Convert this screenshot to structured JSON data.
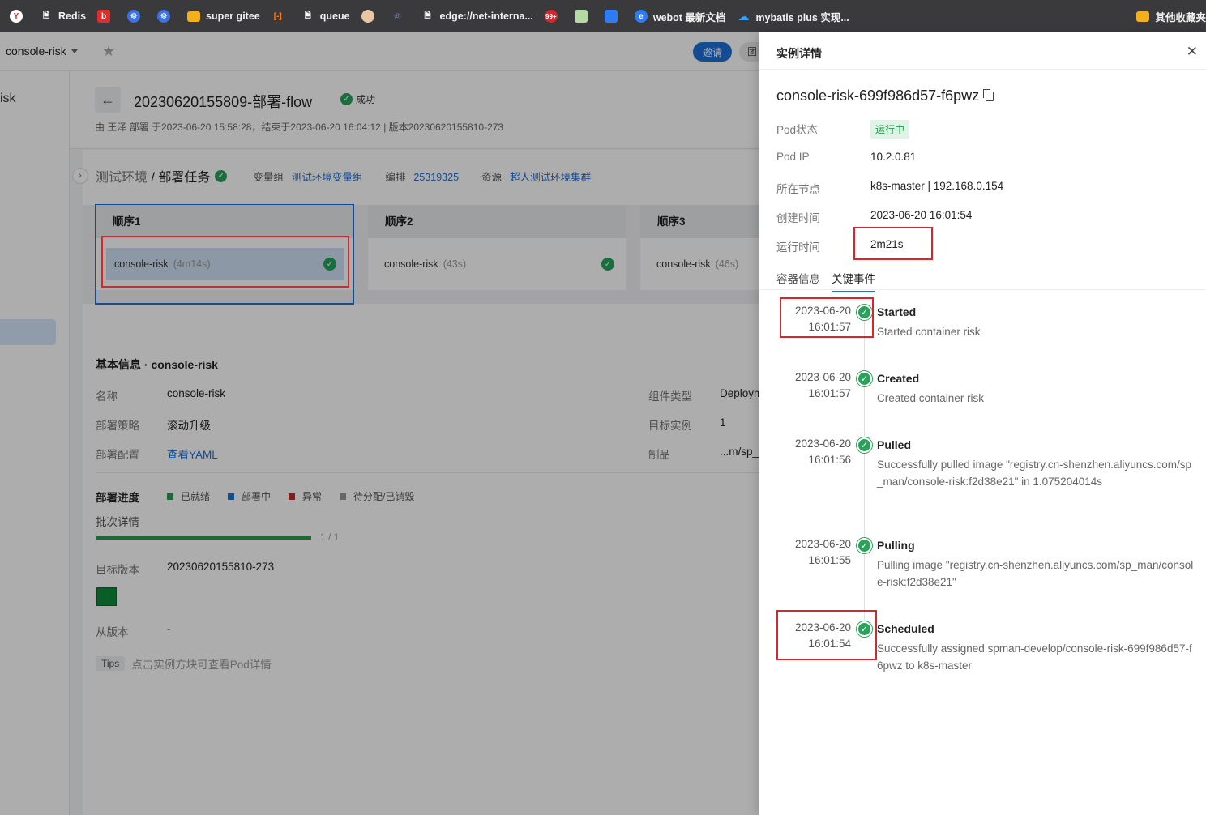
{
  "bookmarks": [
    {
      "label": "",
      "icon": "yandex-icon",
      "color": "#ffffff"
    },
    {
      "label": "Redis",
      "icon": "file-icon",
      "color": "#ffffff"
    },
    {
      "label": "",
      "icon": "bilibili-icon",
      "color": "#e32b2b"
    },
    {
      "label": "",
      "icon": "kubernetes-icon",
      "color": "#3b73e0"
    },
    {
      "label": "",
      "icon": "kubernetes-icon",
      "color": "#3b73e0"
    },
    {
      "label": "super gitee",
      "icon": "folder-icon",
      "color": "#f2b01e"
    },
    {
      "label": "",
      "icon": "code-bracket-icon",
      "color": "#ff7a1a"
    },
    {
      "label": "queue",
      "icon": "file-icon",
      "color": "#ffffff"
    },
    {
      "label": "",
      "icon": "avatar-icon",
      "color": "#e9c6a4"
    },
    {
      "label": "",
      "icon": "fingerprint-icon",
      "color": "#4b8ef7"
    },
    {
      "label": "edge://net-interna...",
      "icon": "file-icon",
      "color": "#ffffff"
    },
    {
      "label": "",
      "icon": "counter-badge-icon",
      "color": "#d9262b",
      "badge": "99+"
    },
    {
      "label": "",
      "icon": "image-icon",
      "color": "#b7d9a6"
    },
    {
      "label": "",
      "icon": "cloud-doc-icon",
      "color": "#2d7cf6"
    },
    {
      "label": "webot 最新文档",
      "icon": "edge-icon",
      "color": "#2d7cf6"
    },
    {
      "label": "mybatis plus 实现...",
      "icon": "cloud-icon",
      "color": "#3aa1f2"
    }
  ],
  "bookmarks_right": {
    "label": "其他收藏夹",
    "icon": "folder-icon"
  },
  "app": {
    "project": "console-risk",
    "invite_label": "邀请",
    "invite2_label": "团",
    "sidebar_label": "isk",
    "flow": {
      "title": "20230620155809-部署-flow",
      "status": "成功",
      "meta": "由 王泽 部署  于2023-06-20 15:58:28，结束于2023-06-20 16:04:12  |  版本20230620155810-273"
    },
    "env": {
      "name_prefix": "测试环境",
      "name_sep": " / ",
      "name_task": "部署任务",
      "var_label": "变量组",
      "var_value": "测试环境变量组",
      "arrange_label": "编排",
      "arrange_value": "25319325",
      "resource_label": "资源",
      "resource_value": "超人测试环境集群"
    },
    "stages": [
      {
        "title": "顺序1",
        "instance": "console-risk",
        "duration": "(4m14s)"
      },
      {
        "title": "顺序2",
        "instance": "console-risk",
        "duration": "(43s)"
      },
      {
        "title": "顺序3",
        "instance": "console-risk",
        "duration": "(46s)"
      }
    ],
    "basic": {
      "title": "基本信息 · console-risk",
      "name_label": "名称",
      "name_value": "console-risk",
      "strategy_label": "部署策略",
      "strategy_value": "滚动升级",
      "config_label": "部署配置",
      "config_value": "查看YAML",
      "comp_type_label": "组件类型",
      "comp_type_value": "Deploym",
      "target_inst_label": "目标实例",
      "target_inst_value": "1",
      "artifact_label": "制品",
      "artifact_value": "...m/sp_"
    },
    "progress": {
      "title": "部署进度",
      "legend": [
        {
          "label": "已就绪",
          "color": "#2a9b4f"
        },
        {
          "label": "部署中",
          "color": "#1f6fd6"
        },
        {
          "label": "异常",
          "color": "#c22d2d"
        },
        {
          "label": "待分配/已销毁",
          "color": "#999999"
        }
      ],
      "batch_label": "批次详情",
      "batch_count": "1 / 1",
      "batch_fraction": 1.0,
      "target_label": "目标版本",
      "target_value": "20230620155810-273",
      "from_label": "从版本",
      "from_value": "-",
      "tips_tag": "Tips",
      "tips_text": "点击实例方块可查看Pod详情"
    }
  },
  "drawer": {
    "title": "实例详情",
    "pod_name": "console-risk-699f986d57-f6pwz",
    "fields": {
      "status_label": "Pod状态",
      "status_value": "运行中",
      "ip_label": "Pod IP",
      "ip_value": "10.2.0.81",
      "node_label": "所在节点",
      "node_value": "k8s-master | 192.168.0.154",
      "created_label": "创建时间",
      "created_value": "2023-06-20 16:01:54",
      "uptime_label": "运行时间",
      "uptime_value": "2m21s"
    },
    "tabs": [
      "容器信息",
      "关键事件"
    ],
    "active_tab": "关键事件",
    "events": [
      {
        "date": "2023-06-20",
        "time": "16:01:57",
        "name": "Started",
        "message": "Started container risk"
      },
      {
        "date": "2023-06-20",
        "time": "16:01:57",
        "name": "Created",
        "message": "Created container risk"
      },
      {
        "date": "2023-06-20",
        "time": "16:01:56",
        "name": "Pulled",
        "message": "Successfully pulled image \"registry.cn-shenzhen.aliyuncs.com/sp_man/console-risk:f2d38e21\" in 1.075204014s"
      },
      {
        "date": "2023-06-20",
        "time": "16:01:55",
        "name": "Pulling",
        "message": "Pulling image \"registry.cn-shenzhen.aliyuncs.com/sp_man/console-risk:f2d38e21\""
      },
      {
        "date": "2023-06-20",
        "time": "16:01:54",
        "name": "Scheduled",
        "message": "Successfully assigned spman-develop/console-risk-699f986d57-f6pwz to k8s-master"
      }
    ]
  }
}
